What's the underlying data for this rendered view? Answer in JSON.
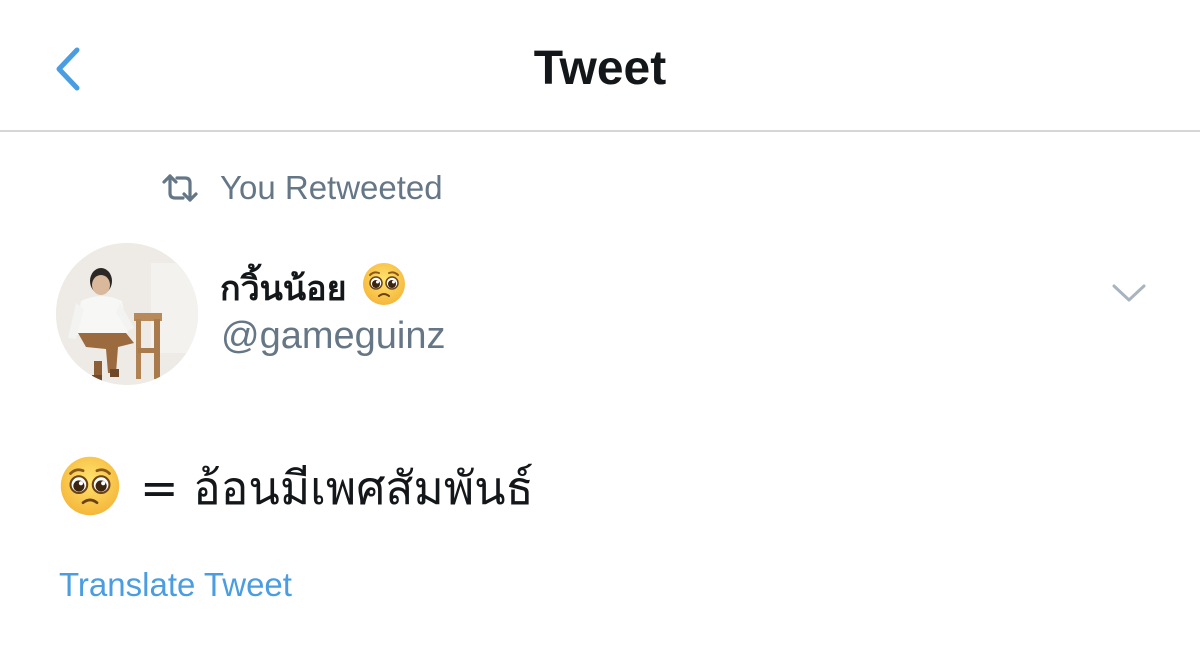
{
  "header": {
    "title": "Tweet",
    "back_icon": "chevron-left-icon"
  },
  "retweet_context": {
    "icon": "retweet-icon",
    "text": "You Retweeted"
  },
  "author": {
    "display_name": "กวิ้นน้อย",
    "name_emoji": "pleading-face-emoji",
    "handle": "@gameguinz",
    "avatar": "profile-photo"
  },
  "menu": {
    "icon": "chevron-down-icon"
  },
  "tweet": {
    "emoji": "pleading-face-emoji",
    "text": "= อ้อนมีเพศสัมพันธ์"
  },
  "translate": {
    "label": "Translate Tweet"
  },
  "colors": {
    "accent": "#4a9de0",
    "primary_text": "#14171a",
    "secondary_text": "#657786",
    "divider": "#d6d6d6"
  }
}
